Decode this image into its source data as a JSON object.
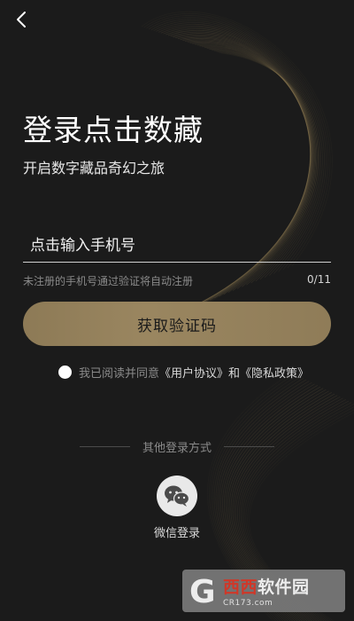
{
  "header": {
    "back_icon": "chevron-left-icon"
  },
  "login": {
    "title": "登录点击数藏",
    "subtitle": "开启数字藏品奇幻之旅"
  },
  "phone": {
    "value": "",
    "placeholder": "点击输入手机号",
    "hint": "未注册的手机号通过验证将自动注册",
    "counter": "0/11"
  },
  "get_code_button": "获取验证码",
  "agreement": {
    "checked": false,
    "prefix": "我已阅读并同意",
    "user_agreement": "《用户协议》",
    "and": "和",
    "privacy_policy": "《隐私政策》"
  },
  "other_login": {
    "title": "其他登录方式",
    "wechat_label": "微信登录",
    "wechat_icon": "wechat-icon"
  },
  "watermark": {
    "letter": "G",
    "name_red": "西西",
    "name_white": "软件园",
    "url": "CR173.com"
  },
  "colors": {
    "background": "#1b1b1b",
    "button_gold": "#9a8660",
    "swirl_gold": "#a08a5c"
  }
}
